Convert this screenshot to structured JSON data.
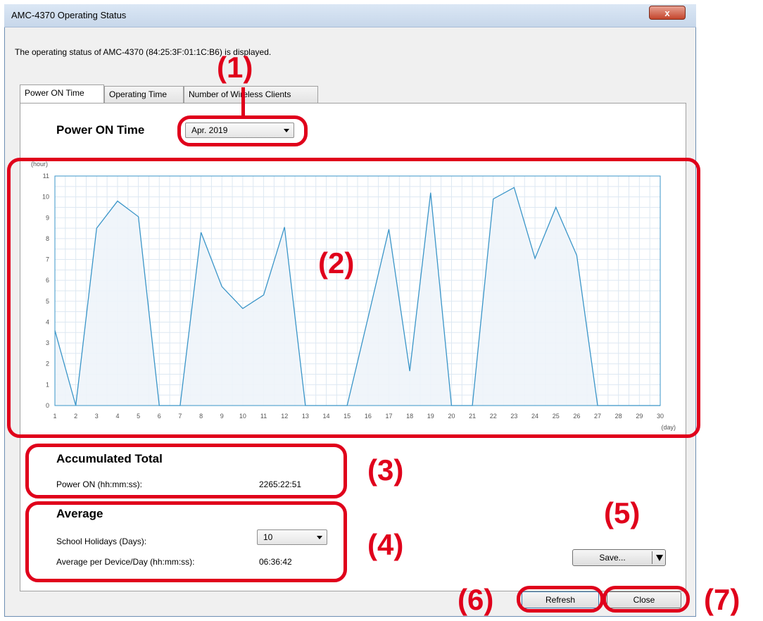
{
  "window": {
    "title": "AMC-4370 Operating Status",
    "close_glyph": "x"
  },
  "description": "The operating status of AMC-4370 (84:25:3F:01:1C:B6) is displayed.",
  "tabs": [
    {
      "label": "Power ON Time",
      "active": true
    },
    {
      "label": "Operating Time",
      "active": false
    },
    {
      "label": "Number of Wireless Clients",
      "active": false
    }
  ],
  "panel": {
    "heading": "Power ON Time",
    "month_select": "Apr. 2019"
  },
  "accumulated": {
    "heading": "Accumulated Total",
    "power_on_label": "Power ON (hh:mm:ss):",
    "power_on_value": "2265:22:51"
  },
  "average": {
    "heading": "Average",
    "holidays_label": "School Holidays (Days):",
    "holidays_value": "10",
    "per_device_label": "Average per Device/Day (hh:mm:ss):",
    "per_device_value": "06:36:42"
  },
  "buttons": {
    "save": "Save...",
    "refresh": "Refresh",
    "close": "Close"
  },
  "callouts": [
    "(1)",
    "(2)",
    "(3)",
    "(4)",
    "(5)",
    "(6)",
    "(7)"
  ],
  "colors": {
    "callout_red": "#e0001b",
    "series_line": "#3a95c8",
    "series_fill": "#eef4fa",
    "grid": "#dde8f2"
  },
  "chart_data": {
    "type": "area",
    "xlabel": "(day)",
    "ylabel": "(hour)",
    "x": [
      1,
      2,
      3,
      4,
      5,
      6,
      7,
      8,
      9,
      10,
      11,
      12,
      13,
      14,
      15,
      16,
      17,
      18,
      19,
      20,
      21,
      22,
      23,
      24,
      25,
      26,
      27,
      28,
      29,
      30
    ],
    "series": [
      {
        "values": [
          3.6,
          0,
          8.5,
          9.8,
          9.05,
          0,
          0,
          8.3,
          5.7,
          4.65,
          5.3,
          8.55,
          0,
          0,
          0,
          4.2,
          8.45,
          1.65,
          10.2,
          0,
          0,
          9.9,
          10.45,
          7.05,
          9.5,
          7.2,
          0,
          0,
          0,
          0
        ]
      }
    ],
    "xlim": [
      1,
      30
    ],
    "ylim": [
      0,
      11
    ],
    "yticks": [
      0,
      1,
      2,
      3,
      4,
      5,
      6,
      7,
      8,
      9,
      10,
      11
    ],
    "grid": true
  }
}
